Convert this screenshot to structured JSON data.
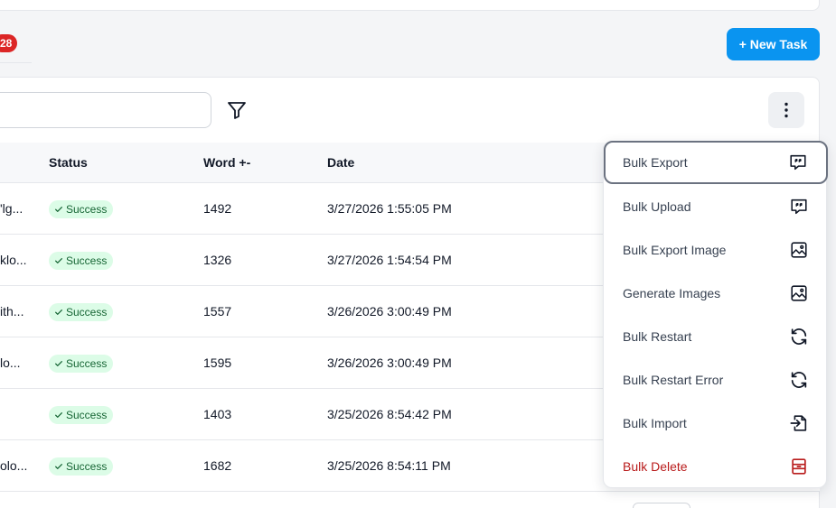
{
  "header": {
    "task_count": "28",
    "new_task_label": "+ New Task"
  },
  "table": {
    "columns": [
      "Status",
      "Word +-",
      "Date"
    ],
    "rows": [
      {
        "name": "ʹlg...",
        "status": "Success",
        "words": "1492",
        "date": "3/27/2026 1:55:05 PM"
      },
      {
        "name": "klo...",
        "status": "Success",
        "words": "1326",
        "date": "3/27/2026 1:54:54 PM"
      },
      {
        "name": "ith...",
        "status": "Success",
        "words": "1557",
        "date": "3/26/2026 3:00:49 PM"
      },
      {
        "name": "lo...",
        "status": "Success",
        "words": "1595",
        "date": "3/26/2026 3:00:49 PM"
      },
      {
        "name": "",
        "status": "Success",
        "words": "1403",
        "date": "3/25/2026 8:54:42 PM"
      },
      {
        "name": "olo...",
        "status": "Success",
        "words": "1682",
        "date": "3/25/2026 8:54:11 PM"
      }
    ]
  },
  "menu": {
    "items": [
      {
        "label": "Bulk Export",
        "icon": "quote-message-icon"
      },
      {
        "label": "Bulk Upload",
        "icon": "quote-message-icon"
      },
      {
        "label": "Bulk Export Image",
        "icon": "image-icon"
      },
      {
        "label": "Generate Images",
        "icon": "image-icon"
      },
      {
        "label": "Bulk Restart",
        "icon": "refresh-icon"
      },
      {
        "label": "Bulk Restart Error",
        "icon": "refresh-icon"
      },
      {
        "label": "Bulk Import",
        "icon": "import-icon"
      },
      {
        "label": "Bulk Delete",
        "icon": "archive-delete-icon"
      }
    ]
  },
  "colors": {
    "primary": "#0a94f0",
    "badge_red": "#dc2626",
    "success_bg": "#dcfce7",
    "success_text": "#166534",
    "danger": "#b91c1c"
  }
}
